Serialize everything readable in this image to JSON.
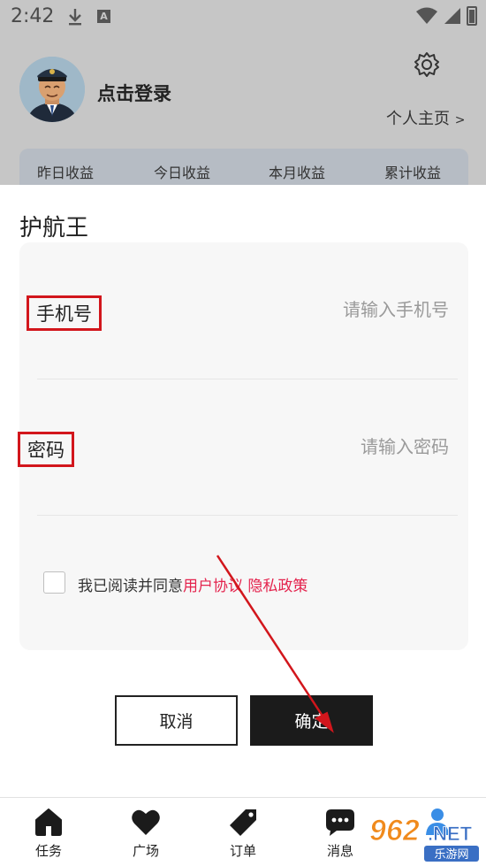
{
  "status_bar": {
    "time": "2:42",
    "a_badge": "A"
  },
  "header": {
    "login_text": "点击登录",
    "profile_link": "个人主页",
    "profile_chevron": ">"
  },
  "earnings": {
    "labels": [
      "昨日收益",
      "今日收益",
      "本月收益",
      "累计收益"
    ]
  },
  "dialog": {
    "title": "护航王",
    "phone": {
      "label": "手机号",
      "placeholder": "请输入手机号",
      "value": ""
    },
    "password": {
      "label": "密码",
      "placeholder": "请输入密码",
      "value": ""
    },
    "agreement": {
      "prefix": "我已阅读并同意",
      "terms_link": "用户协议",
      "privacy_link": "隐私政策",
      "checked": false
    },
    "cancel_label": "取消",
    "confirm_label": "确定"
  },
  "bottom_nav": {
    "items": [
      {
        "label": "任务",
        "icon": "home-icon"
      },
      {
        "label": "广场",
        "icon": "heart-icon"
      },
      {
        "label": "订单",
        "icon": "tag-icon"
      },
      {
        "label": "消息",
        "icon": "chat-icon"
      },
      {
        "label": "",
        "icon": "person-icon"
      }
    ]
  },
  "watermark": {
    "brand": "962.NET",
    "sub": "乐游网"
  },
  "colors": {
    "annotation_red": "#d2161c",
    "link_pink": "#e4234d",
    "confirm_bg": "#1b1b1b",
    "overlay_gray": "#c6c6c6"
  }
}
